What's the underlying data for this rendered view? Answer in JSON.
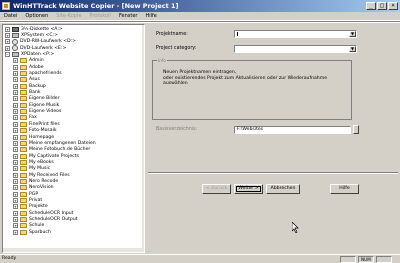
{
  "window": {
    "title": "WinHTTrack Website Copier - [New Project 1]",
    "controls": [
      "minimize",
      "maximize",
      "close"
    ]
  },
  "menu": {
    "items": [
      {
        "label": "Datei",
        "enabled": true
      },
      {
        "label": "Optionen",
        "enabled": true
      },
      {
        "label": "Site-Kopie",
        "enabled": false
      },
      {
        "label": "Protokoll",
        "enabled": false
      },
      {
        "label": "Fenster",
        "enabled": true
      },
      {
        "label": "Hilfe",
        "enabled": true
      }
    ]
  },
  "tree": {
    "drives": [
      {
        "label": "3½-Diskette <A:>",
        "icon": "floppy-icon"
      },
      {
        "label": "XPSystem <C:>",
        "icon": "drive-icon"
      },
      {
        "label": "DVD-RW-Laufwerk <D:>",
        "icon": "cd-icon"
      },
      {
        "label": "DVD-Laufwerk <E:>",
        "icon": "cd-icon"
      },
      {
        "label": "XPDaten <P:>",
        "icon": "drive-icon"
      }
    ],
    "folders": [
      "Admin",
      "Adobe",
      "apachefriends",
      "Asus",
      "Backup",
      "Bank",
      "Eigene Bilder",
      "Eigene Musik",
      "Eigene Videos",
      "Fax",
      "FinePrint files",
      "Foto-Mosaik",
      "Homepage",
      "Meine empfangenen Dateien",
      "Meine Fotobuch.de Bücher",
      "My Captivate Projects",
      "My eBooks",
      "My Music",
      "My Received Files",
      "Nero Recode",
      "NeroVision",
      "PGP",
      "Privat",
      "Projekte",
      "ScheduleOCR Input",
      "ScheduleOCR Output",
      "Schule",
      "Sparbuch"
    ]
  },
  "form": {
    "project_name_label": "Projektname:",
    "project_name_value": "",
    "project_category_label": "Project category:",
    "project_category_value": "",
    "info_legend": "Info",
    "info_line1": "Neuen Projektnamen eintragen,",
    "info_line2": "oder existierendes Projekt zum Aktualisieren oder zur Wiederaufnahme",
    "info_line3": "auswählen",
    "base_path_label": "Basisverzeichnis:",
    "base_path_value": "F:\\Websites"
  },
  "buttons": {
    "back": "< Zurück",
    "next": "Weiter >",
    "cancel": "Abbrechen",
    "help": "Hilfe"
  },
  "status": {
    "text": "Ready",
    "num": "NUM"
  }
}
